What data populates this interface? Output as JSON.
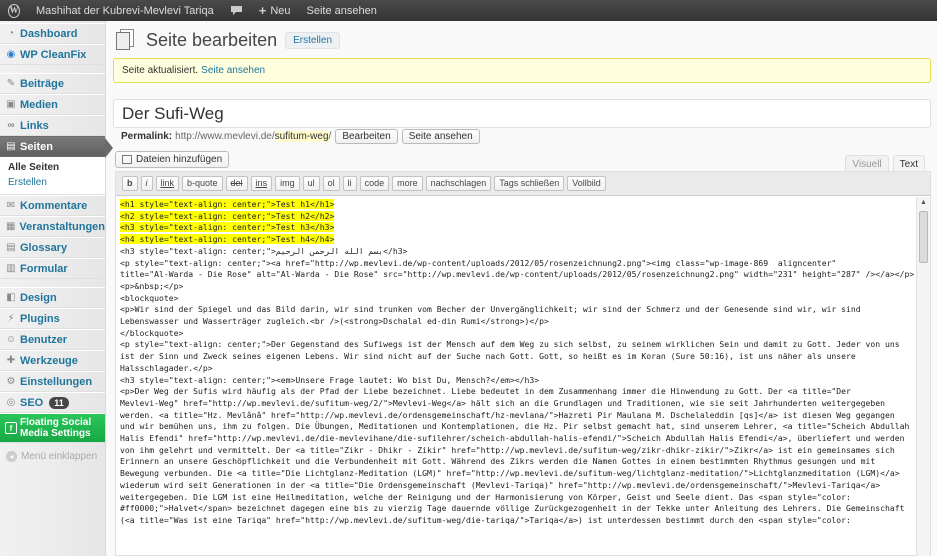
{
  "adminbar": {
    "site_title": "Mashihat der Kubrevi-Mevlevi Tariqa",
    "new_label": "Neu",
    "view_page": "Seite ansehen"
  },
  "sidebar": {
    "items": [
      {
        "label": "Dashboard",
        "icon": "dashboard-icon"
      },
      {
        "label": "WP CleanFix",
        "icon": "cleanfix-icon"
      },
      {
        "label": "Beiträge",
        "icon": "pin-icon"
      },
      {
        "label": "Medien",
        "icon": "media-icon"
      },
      {
        "label": "Links",
        "icon": "link-icon"
      },
      {
        "label": "Seiten",
        "icon": "pages-icon"
      },
      {
        "label": "Kommentare",
        "icon": "comments-icon"
      },
      {
        "label": "Veranstaltungen",
        "icon": "events-icon"
      },
      {
        "label": "Glossary",
        "icon": "glossary-icon"
      },
      {
        "label": "Formular",
        "icon": "form-icon"
      },
      {
        "label": "Design",
        "icon": "appearance-icon"
      },
      {
        "label": "Plugins",
        "icon": "plugins-icon"
      },
      {
        "label": "Benutzer",
        "icon": "users-icon"
      },
      {
        "label": "Werkzeuge",
        "icon": "tools-icon"
      },
      {
        "label": "Einstellungen",
        "icon": "settings-icon"
      },
      {
        "label": "SEO",
        "icon": "seo-icon",
        "badge": "11"
      },
      {
        "label": "Floating Social Media Settings",
        "icon": "social-icon"
      }
    ],
    "submenu": [
      "Alle Seiten",
      "Erstellen"
    ],
    "collapse": "Menü einklappen"
  },
  "header": {
    "title": "Seite bearbeiten",
    "add_new": "Erstellen"
  },
  "notice": {
    "text": "Seite aktualisiert.",
    "link": "Seite ansehen"
  },
  "post": {
    "title": "Der Sufi-Weg",
    "permalink_label": "Permalink:",
    "permalink_base": "http://www.mevlevi.de/",
    "permalink_slug": "sufitum-weg",
    "permalink_end": "/",
    "edit_button": "Bearbeiten",
    "view_button": "Seite ansehen"
  },
  "editor": {
    "media_button": "Dateien hinzufügen",
    "tab_visual": "Visuell",
    "tab_text": "Text",
    "quicktags": [
      "b",
      "i",
      "link",
      "b-quote",
      "del",
      "ins",
      "img",
      "ul",
      "ol",
      "li",
      "code",
      "more",
      "nachschlagen",
      "Tags schließen",
      "Vollbild"
    ],
    "highlight_lines": [
      "<h1 style=\"text-align: center;\">Test h1</h1>",
      "<h2 style=\"text-align: center;\">Test h2</h2>",
      "<h3 style=\"text-align: center;\">Test h3</h3>",
      "<h4 style=\"text-align: center;\">Test h4</h4>"
    ],
    "lines": [
      "<h3 style=\"text-align: center;\">بسم الله الرحمن الرحيم</h3>",
      "<p style=\"text-align: center;\"><a href=\"http://wp.mevlevi.de/wp-content/uploads/2012/05/rosenzeichnung2.png\"><img class=\"wp-image-869  aligncenter\"",
      "title=\"Al-Warda - Die Rose\" alt=\"Al-Warda - Die Rose\" src=\"http://wp.mevlevi.de/wp-content/uploads/2012/05/rosenzeichnung2.png\" width=\"231\" height=\"287\" /></a></p>",
      "<p>&nbsp;</p>",
      "<blockquote>",
      "<p>Wir sind der Spiegel und das Bild darin, wir sind trunken vom Becher der Unvergänglichkeit; wir sind der Schmerz und der Genesende sind wir, wir sind",
      "Lebenswasser und Wasserträger zugleich.<br />(<strong>Dschalal ed-din Rumi</strong>)</p>",
      "</blockquote>",
      "<p style=\"text-align: center;\">Der Gegenstand des Sufiwegs ist der Mensch auf dem Weg zu sich selbst, zu seinem wirklichen Sein und damit zu Gott. Jeder von uns",
      "ist der Sinn und Zweck seines eigenen Lebens. Wir sind nicht auf der Suche nach Gott. Gott, so heißt es im Koran (Sure 50:16), ist uns näher als unsere",
      "Halsschlagader.</p>",
      "<h3 style=\"text-align: center;\"><em>Unsere Frage lautet: Wo bist Du, Mensch?</em></h3>",
      "<p>Der Weg der Sufis wird häufig als der Pfad der Liebe bezeichnet. Liebe bedeutet in dem Zusammenhang immer die Hinwendung zu Gott. Der <a title=\"Der",
      "Mevlevi-Weg\" href=\"http://wp.mevlevi.de/sufitum-weg/2/\">Mevlevi-Weg</a> hält sich an die Grundlagen und Traditionen, wie sie seit Jahrhunderten weitergegeben",
      "werden. <a title=\"Hz. Mevlânâ\" href=\"http://wp.mevlevi.de/ordensgemeinschaft/hz-mevlana/\">Hazreti Pir Maulana M. Dschelaleddin [qs]</a> ist diesen Weg gegangen",
      "und wir bemühen uns, ihm zu folgen. Die Übungen, Meditationen und Kontemplationen, die Hz. Pir selbst gemacht hat, sind unserem Lehrer, <a title=\"Scheich Abdullah",
      "Halis Efendi\" href=\"http://wp.mevlevi.de/die-mevlevihane/die-sufilehrer/scheich-abdullah-halis-efendi/\">Scheich Abdullah Halis Efendi</a>, überliefert und werden",
      "von ihm gelehrt und vermittelt. Der <a title=\"Zikr - Dhikr - Zikir\" href=\"http://wp.mevlevi.de/sufitum-weg/zikr-dhikr-zikir/\">Zikr</a> ist ein gemeinsames sich",
      "Erinnern an unsere Geschöpflichkeit und die Verbundenheit mit Gott. Während des Zikrs werden die Namen Gottes in einem bestimmten Rhythmus gesungen und mit",
      "Bewegung verbunden. Die <a title=\"Die Lichtglanz-Meditation (LGM)\" href=\"http://wp.mevlevi.de/sufitum-weg/lichtglanz-meditation/\">Lichtglanzmeditation (LGM)</a>",
      "wiederum wird seit Generationen in der <a title=\"Die Ordensgemeinschaft (Mevlevi-Tariqa)\" href=\"http://wp.mevlevi.de/ordensgemeinschaft/\">Mevlevi-Tariqa</a>",
      "weitergegeben. Die LGM ist eine Heilmeditation, welche der Reinigung und der Harmonisierung von Körper, Geist und Seele dient. Das <span style=\"color:",
      "#ff0000;\">Halvet</span> bezeichnet dagegen eine bis zu vierzig Tage dauernde völlige Zurückgezogenheit in der Tekke unter Anleitung des Lehrers. Die Gemeinschaft",
      "(<a title=\"Was ist eine Tariqa\" href=\"http://wp.mevlevi.de/sufitum-weg/die-tariqa/\">Tariqa</a>) ist unterdessen bestimmt durch den <span style=\"color:"
    ]
  }
}
